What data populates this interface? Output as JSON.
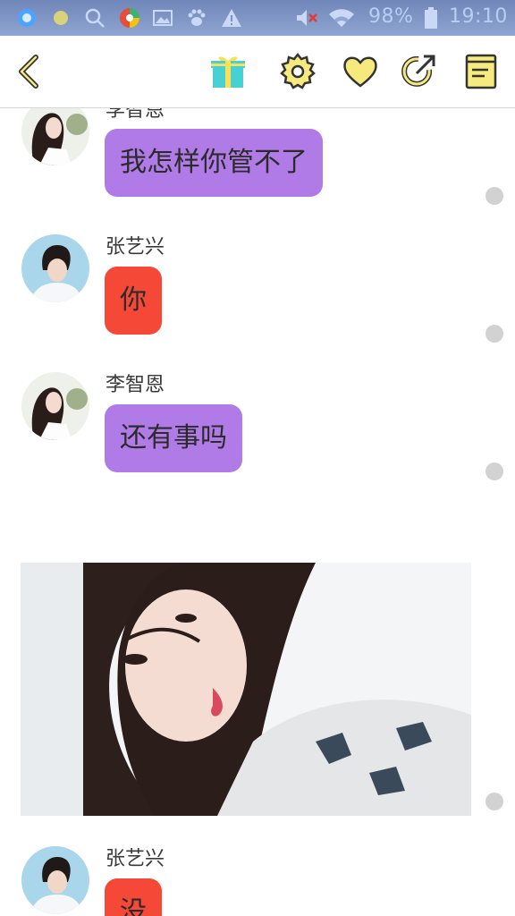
{
  "status_bar": {
    "battery": "98%",
    "time": "19:10"
  },
  "toolbar": {
    "icons": [
      "back-icon",
      "gift-icon",
      "gear-icon",
      "heart-icon",
      "share-icon",
      "notebook-icon"
    ]
  },
  "colors": {
    "bubble_purple": "#b07be6",
    "bubble_red": "#f54836",
    "accent_yellow": "#f6ea7e",
    "status_bar": "#7b93c4"
  },
  "messages": [
    {
      "sender": "李智恩",
      "text": "我怎样你管不了",
      "color": "#b07be6"
    },
    {
      "sender": "张艺兴",
      "text": "你",
      "color": "#f54836"
    },
    {
      "sender": "李智恩",
      "text": "还有事吗",
      "color": "#b07be6"
    },
    {
      "sender": "",
      "text": "",
      "type": "image"
    },
    {
      "sender": "张艺兴",
      "text": "没",
      "color": "#f54836"
    }
  ]
}
